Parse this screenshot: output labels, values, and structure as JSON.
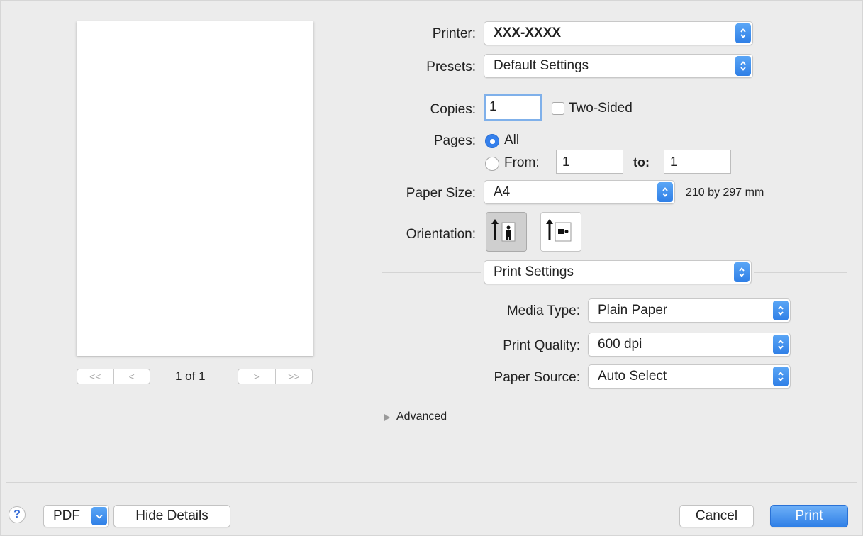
{
  "printer": {
    "label": "Printer:",
    "value": "XXX-XXXX"
  },
  "presets": {
    "label": "Presets:",
    "value": "Default Settings"
  },
  "copies": {
    "label": "Copies:",
    "value": "1",
    "two_sided_label": "Two-Sided",
    "two_sided_checked": false
  },
  "pages": {
    "label": "Pages:",
    "all_label": "All",
    "all_selected": true,
    "from_label": "From:",
    "from_value": "1",
    "to_label": "to:",
    "to_value": "1"
  },
  "paper_size": {
    "label": "Paper Size:",
    "value": "A4",
    "dimensions": "210 by 297 mm"
  },
  "orientation": {
    "label": "Orientation:",
    "options": [
      "portrait-icon",
      "landscape-icon"
    ],
    "selected": "portrait-icon"
  },
  "section_popup": {
    "value": "Print Settings"
  },
  "media_type": {
    "label": "Media Type:",
    "value": "Plain Paper"
  },
  "print_quality": {
    "label": "Print Quality:",
    "value": "600 dpi"
  },
  "paper_source": {
    "label": "Paper Source:",
    "value": "Auto Select"
  },
  "advanced": {
    "label": "Advanced"
  },
  "preview": {
    "page_indicator": "1 of 1",
    "first_glyph": "<<",
    "prev_glyph": "<",
    "next_glyph": ">",
    "last_glyph": ">>"
  },
  "footer": {
    "help_glyph": "?",
    "pdf_label": "PDF",
    "hide_details_label": "Hide Details",
    "cancel_label": "Cancel",
    "print_label": "Print"
  },
  "colors": {
    "accent": "#2f7fe6",
    "dialog_bg": "#ececec"
  }
}
